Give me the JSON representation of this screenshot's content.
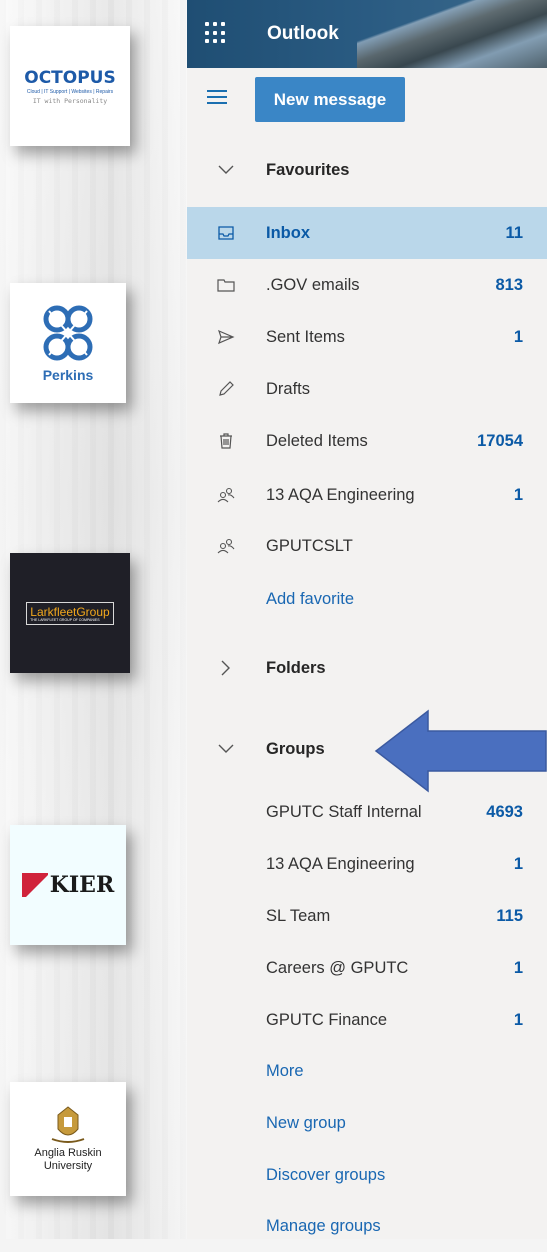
{
  "logos": {
    "octopus": {
      "name": "OCTOPUS",
      "tagline": "Cloud | IT Support | Websites | Repairs",
      "slogan": "IT with Personality"
    },
    "perkins": {
      "name": "Perkins"
    },
    "larkfleet": {
      "name": "LarkfleetGroup",
      "sub": "THE LARKFLEET GROUP OF COMPANIES"
    },
    "kier": {
      "name": "KIER"
    },
    "anglia": {
      "line1": "Anglia Ruskin",
      "line2": "University"
    }
  },
  "app": {
    "title": "Outlook"
  },
  "toolbar": {
    "new_message": "New message"
  },
  "favourites": {
    "header": "Favourites",
    "items": [
      {
        "label": "Inbox",
        "count": "11",
        "icon": "inbox-icon"
      },
      {
        "label": ".GOV emails",
        "count": "813",
        "icon": "folder-icon"
      },
      {
        "label": "Sent Items",
        "count": "1",
        "icon": "send-icon"
      },
      {
        "label": "Drafts",
        "count": "",
        "icon": "pencil-icon"
      },
      {
        "label": "Deleted Items",
        "count": "17054",
        "icon": "trash-icon"
      },
      {
        "label": "13 AQA Engineering",
        "count": "1",
        "icon": "group-icon"
      },
      {
        "label": "GPUTCSLT",
        "count": "",
        "icon": "group-icon"
      }
    ],
    "add_link": "Add favorite"
  },
  "folders": {
    "header": "Folders"
  },
  "groups": {
    "header": "Groups",
    "items": [
      {
        "label": "GPUTC Staff Internal",
        "count": "4693"
      },
      {
        "label": "13 AQA Engineering",
        "count": "1"
      },
      {
        "label": "SL Team",
        "count": "115"
      },
      {
        "label": "Careers @ GPUTC",
        "count": "1"
      },
      {
        "label": "GPUTC Finance",
        "count": "1"
      }
    ],
    "links": [
      "More",
      "New group",
      "Discover groups",
      "Manage groups"
    ]
  },
  "colors": {
    "accent": "#0b5aa6",
    "selected_bg": "#bad7ea",
    "button_bg": "#3a86c6",
    "arrow_fill": "#4a6fbf"
  }
}
